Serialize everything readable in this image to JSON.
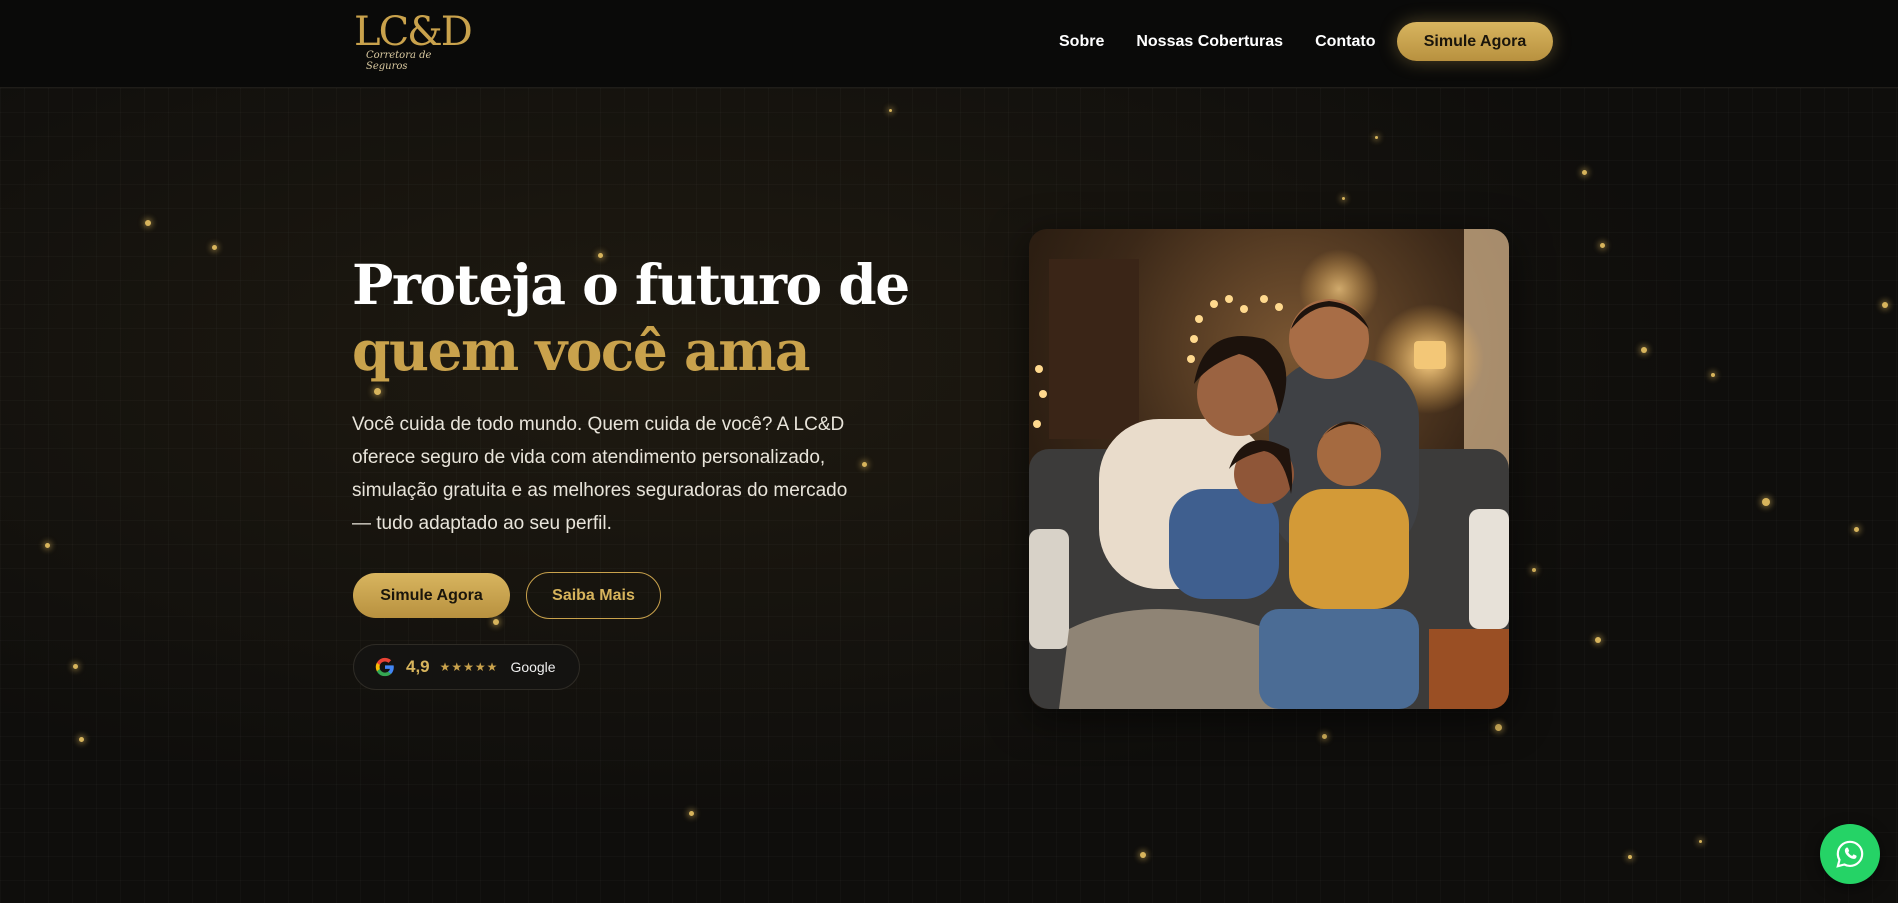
{
  "header": {
    "logo_text": "LC&D",
    "logo_subtitle": "Corretora de Seguros",
    "nav": [
      "Sobre",
      "Nossas Coberturas",
      "Contato"
    ],
    "cta_label": "Simule Agora"
  },
  "hero": {
    "title_line1": "Proteja o futuro de",
    "title_line2": "quem você ama",
    "description": "Você cuida de todo mundo. Quem cuida de você? A LC&D oferece seguro de vida com atendimento personalizado, simulação gratuita e as melhores seguradoras do mercado — tudo adaptado ao seu perfil.",
    "primary_button": "Simule Agora",
    "secondary_button": "Saiba Mais",
    "rating": {
      "value": "4,9",
      "stars": "★★★★★",
      "source": "Google"
    }
  },
  "icons": {
    "google": "google-icon",
    "whatsapp": "whatsapp-icon",
    "photo": "family-photo"
  },
  "colors": {
    "accent": "#c9a24c",
    "background": "#0f0e0c",
    "whatsapp": "#25d366"
  }
}
